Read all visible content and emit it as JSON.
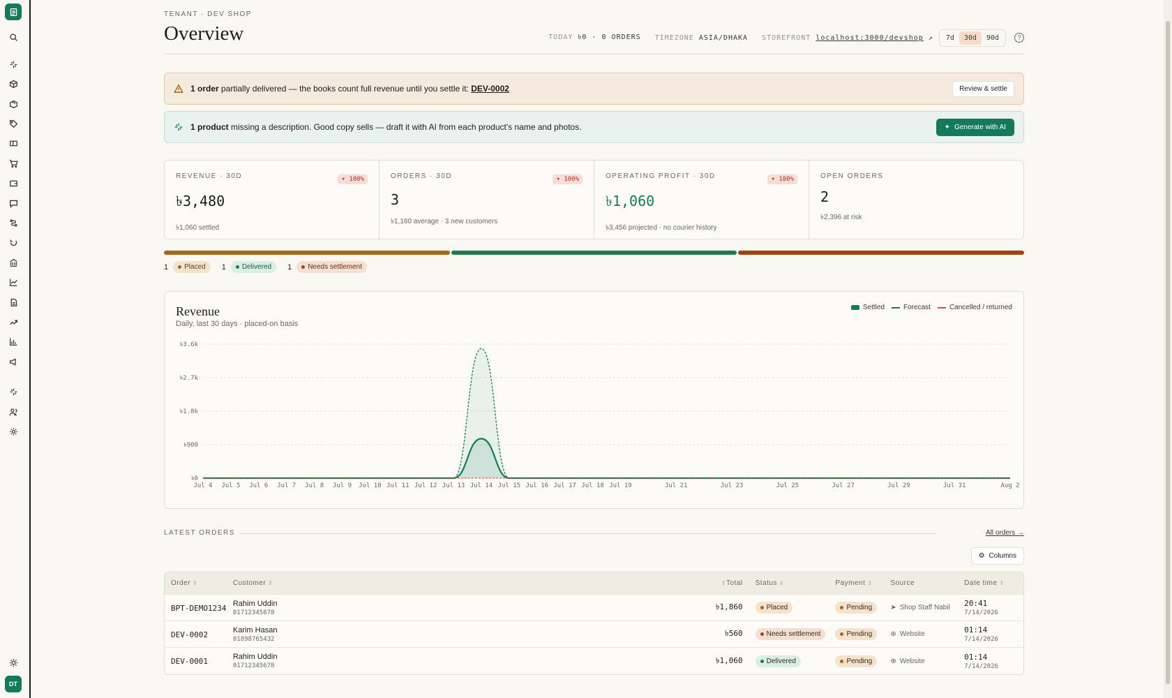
{
  "sidebar": {
    "icons": [
      "search-icon",
      "sparkle-icon",
      "box-icon",
      "package-icon",
      "tag-icon",
      "ticket-icon",
      "cart-icon",
      "wallet-icon",
      "message-icon",
      "route-icon",
      "return-icon",
      "bank-icon",
      "chart-icon",
      "report-icon",
      "trend-icon",
      "bar-chart-icon",
      "megaphone-icon",
      "ai-icon",
      "users-icon",
      "gear-icon",
      "sun-icon"
    ],
    "avatar": "DT"
  },
  "header": {
    "eyebrow": "TENANT · DEV SHOP",
    "title": "Overview",
    "today_label": "TODAY",
    "today_value": "৳0 · 0 ORDERS",
    "timezone_label": "TIMEZONE",
    "timezone_value": "ASIA/DHAKA",
    "storefront_label": "STOREFRONT",
    "storefront_value": "localhost:3000/devshop",
    "ranges": [
      "7d",
      "30d",
      "90d"
    ],
    "active_range": "30d",
    "help": "?"
  },
  "alerts": {
    "warn": {
      "bold": "1 order",
      "text": " partially delivered — the books count full revenue until you settle it: ",
      "link": "DEV-0002",
      "button": "Review & settle"
    },
    "ai": {
      "bold": "1 product",
      "text": " missing a description. Good copy sells — draft it with AI from each product's name and photos.",
      "button": "Generate with AI"
    }
  },
  "kpis": [
    {
      "label": "REVENUE · 30D",
      "badge": "▾ 100%",
      "value": "৳3,480",
      "sub": "৳1,060 settled"
    },
    {
      "label": "ORDERS · 30D",
      "badge": "▾ 100%",
      "value": "3",
      "sub": "৳1,160 average · 3 new customers"
    },
    {
      "label": "OPERATING PROFIT · 30D",
      "badge": "▾ 100%",
      "value": "৳1,060",
      "sub": "৳3,456 projected · no courier history"
    },
    {
      "label": "OPEN ORDERS",
      "value": "2",
      "sub": "৳2,396 at risk"
    }
  ],
  "status_counts": [
    {
      "count": "1",
      "label": "Placed",
      "color": "#a86512"
    },
    {
      "count": "1",
      "label": "Delivered",
      "color": "#1f7a50"
    },
    {
      "count": "1",
      "label": "Needs settlement",
      "color": "#a4420f"
    }
  ],
  "colors": {
    "accent": "#147a5c",
    "placed": "#a86512",
    "delivered": "#1f7a50",
    "settlement": "#a4420f"
  },
  "chart_data": {
    "type": "area",
    "title": "Revenue",
    "subtitle": "Daily, last 30 days · placed-on basis",
    "legend": [
      "Settled",
      "Forecast",
      "Cancelled / returned"
    ],
    "y_ticks": [
      "৳0",
      "৳900",
      "৳1.8k",
      "৳2.7k",
      "৳3.6k"
    ],
    "ylim": [
      0,
      3600
    ],
    "x": [
      "Jul 4",
      "Jul 5",
      "Jul 6",
      "Jul 7",
      "Jul 8",
      "Jul 9",
      "Jul 10",
      "Jul 11",
      "Jul 12",
      "Jul 13",
      "Jul 14",
      "Jul 15",
      "Jul 16",
      "Jul 17",
      "Jul 18",
      "Jul 19",
      "Jul 20",
      "Jul 21",
      "Jul 22",
      "Jul 23",
      "Jul 24",
      "Jul 25",
      "Jul 26",
      "Jul 27",
      "Jul 28",
      "Jul 29",
      "Jul 30",
      "Jul 31",
      "Aug 1",
      "Aug 2"
    ],
    "x_tick_labels": [
      "Jul 4",
      "Jul 5",
      "Jul 6",
      "Jul 7",
      "Jul 8",
      "Jul 9",
      "Jul 10",
      "Jul 11",
      "Jul 12",
      "Jul 13",
      "Jul 14",
      "Jul 15",
      "Jul 16",
      "Jul 17",
      "Jul 18",
      "Jul 19",
      "",
      "Jul 21",
      "",
      "Jul 23",
      "",
      "Jul 25",
      "",
      "Jul 27",
      "",
      "Jul 29",
      "",
      "Jul 31",
      "",
      "Aug 2"
    ],
    "series": [
      {
        "name": "Settled",
        "values": [
          0,
          0,
          0,
          0,
          0,
          0,
          0,
          0,
          0,
          0,
          1060,
          0,
          0,
          0,
          0,
          0,
          0,
          0,
          0,
          0,
          0,
          0,
          0,
          0,
          0,
          0,
          0,
          0,
          0,
          0
        ]
      },
      {
        "name": "Forecast",
        "values": [
          0,
          0,
          0,
          0,
          0,
          0,
          0,
          0,
          0,
          0,
          3480,
          0,
          0,
          0,
          0,
          0,
          0,
          0,
          0,
          0,
          0,
          0,
          0,
          0,
          0,
          0,
          0,
          0,
          0,
          0
        ]
      },
      {
        "name": "Cancelled / returned",
        "values": [
          0,
          0,
          0,
          0,
          0,
          0,
          0,
          0,
          0,
          0,
          0,
          0,
          0,
          0,
          0,
          0,
          0,
          0,
          0,
          0,
          0,
          0,
          0,
          0,
          0,
          0,
          0,
          0,
          0,
          0
        ]
      }
    ],
    "grid": true,
    "legend_position": "top-right"
  },
  "orders": {
    "section_label": "LATEST ORDERS",
    "all_link": "All orders →",
    "columns_button": "Columns",
    "headers": [
      "Order",
      "Customer",
      "Total",
      "Status",
      "Payment",
      "Source",
      "Date time"
    ],
    "rows": [
      {
        "id": "BPT-DEMO1234",
        "name": "Rahim Uddin",
        "phone": "01712345678",
        "total": "৳1,860",
        "status": "Placed",
        "status_color": "#a86512",
        "payment": "Pending",
        "source": "Shop Staff Nabil",
        "source_icon": "send-icon",
        "time": "20:41",
        "date": "7/14/2026"
      },
      {
        "id": "DEV-0002",
        "name": "Karim Hasan",
        "phone": "01898765432",
        "total": "৳560",
        "status": "Needs settlement",
        "status_color": "#a4420f",
        "payment": "Pending",
        "source": "Website",
        "source_icon": "globe-icon",
        "time": "01:14",
        "date": "7/14/2026"
      },
      {
        "id": "DEV-0001",
        "name": "Rahim Uddin",
        "phone": "01712345678",
        "total": "৳1,060",
        "status": "Delivered",
        "status_color": "#1f7a50",
        "payment": "Pending",
        "source": "Website",
        "source_icon": "globe-icon",
        "time": "01:14",
        "date": "7/14/2026"
      }
    ]
  }
}
